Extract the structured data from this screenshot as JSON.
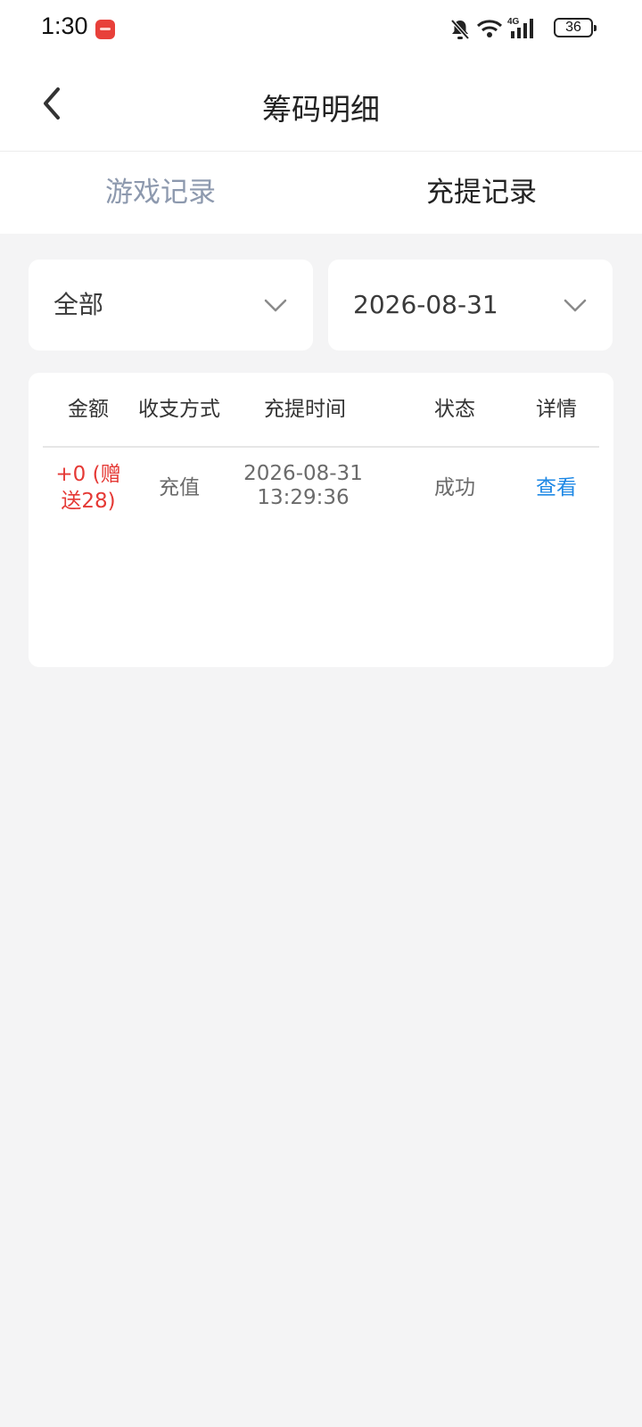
{
  "status_bar": {
    "time": "1:30",
    "battery": "36",
    "icons": [
      "app-notification-icon",
      "bell-off-icon",
      "wifi-icon",
      "signal-4g-icon",
      "battery-icon"
    ]
  },
  "header": {
    "title": "筹码明细",
    "back_icon": "chevron-left-icon"
  },
  "tabs": [
    {
      "label": "游戏记录",
      "active": false
    },
    {
      "label": "充提记录",
      "active": true
    }
  ],
  "filters": {
    "type": {
      "value": "全部",
      "icon": "chevron-down-icon"
    },
    "date": {
      "value": "2026-08-31",
      "icon": "chevron-down-icon"
    }
  },
  "table": {
    "columns": [
      "金额",
      "收支方式",
      "充提时间",
      "状态",
      "详情"
    ],
    "rows": [
      {
        "amount_line1": "+0 (赠",
        "amount_line2": "送28)",
        "method": "充值",
        "date": "2026-08-31",
        "time": "13:29:36",
        "status": "成功",
        "detail": "查看"
      }
    ]
  },
  "colors": {
    "background": "#f4f4f5",
    "tab_inactive": "#8d99ae",
    "amount": "#e53935",
    "link": "#1e88e5"
  }
}
